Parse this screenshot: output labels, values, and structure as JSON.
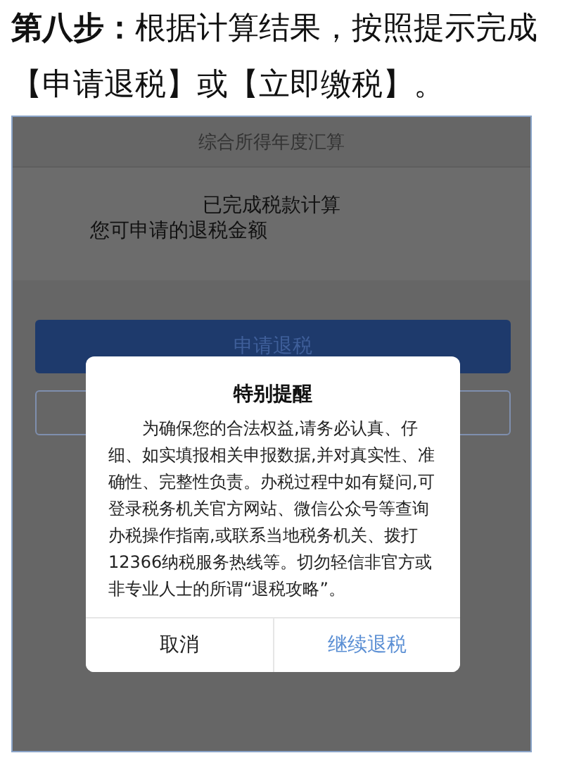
{
  "caption": "**第八步：**根据计算结果，按照提示完成【申请退税】或【立即缴税】。",
  "screen": {
    "title": "综合所得年度汇算",
    "status": "已完成税款计算",
    "refund_label": "您可申请的退税金额",
    "primary_button": "申请退税"
  },
  "dialog": {
    "title": "特别提醒",
    "body": "为确保您的合法权益,请务必认真、仔细、如实填报相关申报数据,并对真实性、准确性、完整性负责。办税过程中如有疑问,可登录税务机关官方网站、微信公众号等查询办税操作指南,或联系当地税务机关、拨打12366纳税服务热线等。切勿轻信非官方或非专业人士的所谓“退税攻略”。",
    "buttons": [
      {
        "label": "取消",
        "kind": "cancel"
      },
      {
        "label": "继续退税",
        "kind": "confirm"
      }
    ]
  }
}
